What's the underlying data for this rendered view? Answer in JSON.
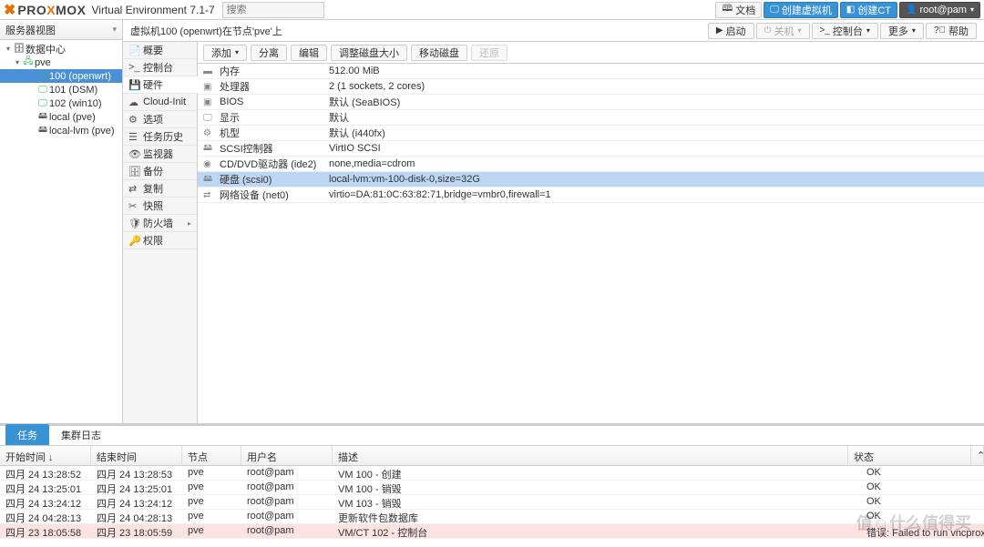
{
  "header": {
    "product": "PROXMOX",
    "env": "Virtual Environment 7.1-7",
    "search_placeholder": "搜索",
    "buttons": {
      "docs": "文档",
      "create_vm": "创建虚拟机",
      "create_ct": "创建CT",
      "user": "root@pam"
    }
  },
  "tree": {
    "header": "服务器视图",
    "items": [
      {
        "label": "数据中心",
        "level": 0,
        "icon": "server",
        "expanded": true
      },
      {
        "label": "pve",
        "level": 1,
        "icon": "node-green",
        "expanded": true
      },
      {
        "label": "100 (openwrt)",
        "level": 2,
        "icon": "vm-green",
        "selected": true
      },
      {
        "label": "101 (DSM)",
        "level": 2,
        "icon": "vm-green"
      },
      {
        "label": "102 (win10)",
        "level": 2,
        "icon": "vm-green"
      },
      {
        "label": "local (pve)",
        "level": 2,
        "icon": "storage"
      },
      {
        "label": "local-lvm (pve)",
        "level": 2,
        "icon": "storage"
      }
    ]
  },
  "content": {
    "title": "虚拟机100 (openwrt)在节点'pve'上",
    "actions": {
      "start": "启动",
      "shutdown": "关机",
      "console": "控制台",
      "more": "更多",
      "help": "帮助"
    },
    "side_tabs": [
      {
        "label": "概要",
        "icon": "📄"
      },
      {
        "label": "控制台",
        "icon": ">_"
      },
      {
        "label": "硬件",
        "icon": "💾",
        "active": true
      },
      {
        "label": "Cloud-Init",
        "icon": "☁"
      },
      {
        "label": "选项",
        "icon": "⚙"
      },
      {
        "label": "任务历史",
        "icon": "☰"
      },
      {
        "label": "监视器",
        "icon": "👁"
      },
      {
        "label": "备份",
        "icon": "🗄"
      },
      {
        "label": "复制",
        "icon": "⇄"
      },
      {
        "label": "快照",
        "icon": "✂"
      },
      {
        "label": "防火墙",
        "icon": "🛡",
        "chev": true
      },
      {
        "label": "权限",
        "icon": "🔑"
      }
    ]
  },
  "hw_toolbar": {
    "add": "添加",
    "detach": "分离",
    "edit": "编辑",
    "resize": "调整磁盘大小",
    "move": "移动磁盘",
    "revert": "还原"
  },
  "hw_rows": [
    {
      "icon": "▬",
      "key": "内存",
      "val": "512.00 MiB"
    },
    {
      "icon": "▣",
      "key": "处理器",
      "val": "2 (1 sockets, 2 cores)"
    },
    {
      "icon": "▣",
      "key": "BIOS",
      "val": "默认 (SeaBIOS)"
    },
    {
      "icon": "🖵",
      "key": "显示",
      "val": "默认"
    },
    {
      "icon": "⚙",
      "key": "机型",
      "val": "默认 (i440fx)"
    },
    {
      "icon": "🖴",
      "key": "SCSI控制器",
      "val": "VirtIO SCSI"
    },
    {
      "icon": "◉",
      "key": "CD/DVD驱动器 (ide2)",
      "val": "none,media=cdrom"
    },
    {
      "icon": "🖴",
      "key": "硬盘 (scsi0)",
      "val": "local-lvm:vm-100-disk-0,size=32G",
      "selected": true
    },
    {
      "icon": "⇄",
      "key": "网络设备 (net0)",
      "val": "virtio=DA:81:0C:63:82:71,bridge=vmbr0,firewall=1"
    }
  ],
  "bottom": {
    "tabs": {
      "tasks": "任务",
      "cluster_log": "集群日志"
    },
    "columns": {
      "start": "开始时间 ↓",
      "end": "结束时间",
      "node": "节点",
      "user": "用户名",
      "desc": "描述",
      "status": "状态"
    },
    "rows": [
      {
        "start": "四月 24 13:28:52",
        "end": "四月 24 13:28:53",
        "node": "pve",
        "user": "root@pam",
        "desc": "VM 100 - 创建",
        "status": "OK"
      },
      {
        "start": "四月 24 13:25:01",
        "end": "四月 24 13:25:01",
        "node": "pve",
        "user": "root@pam",
        "desc": "VM 100 - 销毁",
        "status": "OK"
      },
      {
        "start": "四月 24 13:24:12",
        "end": "四月 24 13:24:12",
        "node": "pve",
        "user": "root@pam",
        "desc": "VM 103 - 销毁",
        "status": "OK"
      },
      {
        "start": "四月 24 04:28:13",
        "end": "四月 24 04:28:13",
        "node": "pve",
        "user": "root@pam",
        "desc": "更新软件包数据库",
        "status": "OK"
      },
      {
        "start": "四月 23 18:05:58",
        "end": "四月 23 18:05:59",
        "node": "pve",
        "user": "root@pam",
        "desc": "VM/CT 102 - 控制台",
        "status": "错误: Failed to run vncproxy",
        "err": true
      }
    ]
  }
}
